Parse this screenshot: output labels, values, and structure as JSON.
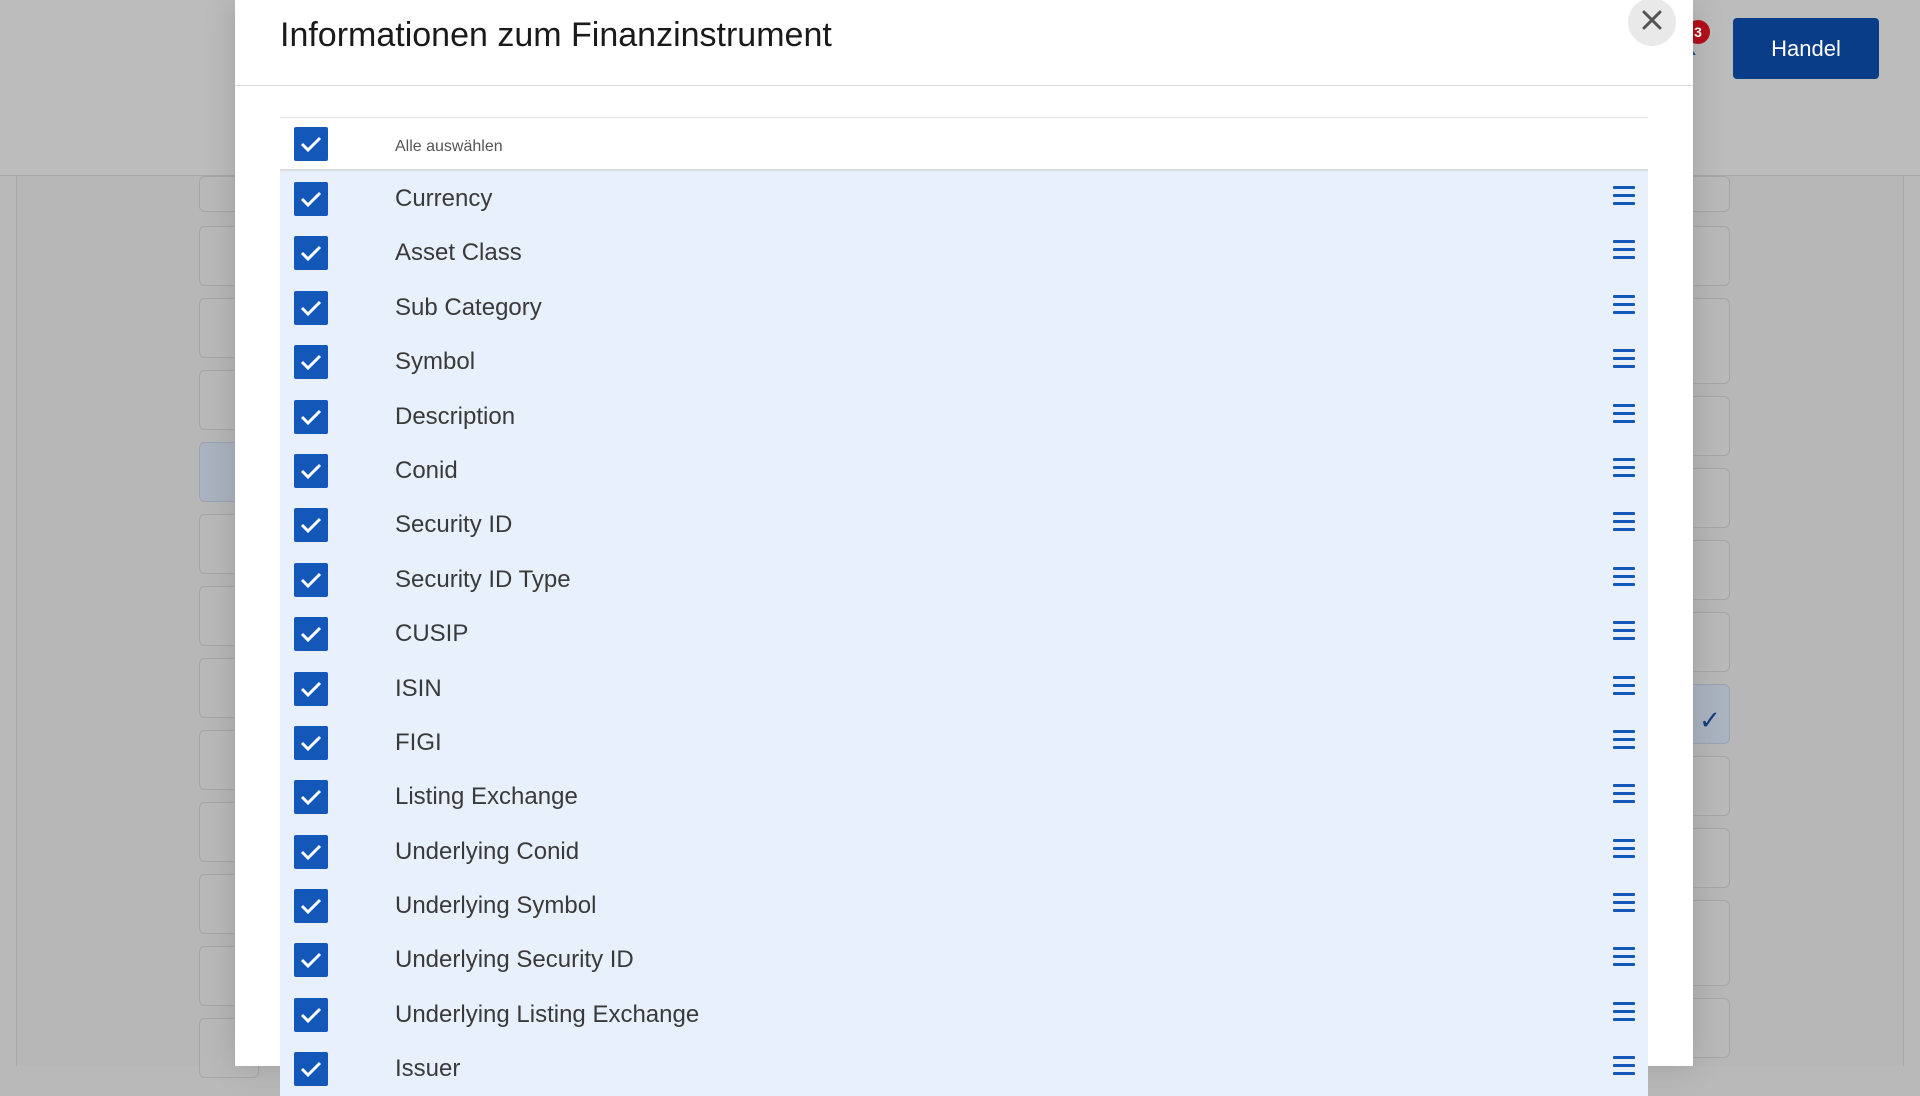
{
  "app": {
    "trade_button_label": "Handel",
    "notification_count": "3"
  },
  "modal": {
    "title": "Informationen zum Finanzinstrument",
    "close_icon": "close-icon",
    "select_all_label": "Alle auswählen",
    "select_all_checked": true,
    "items": [
      {
        "label": "Currency",
        "checked": true
      },
      {
        "label": "Asset Class",
        "checked": true
      },
      {
        "label": "Sub Category",
        "checked": true
      },
      {
        "label": "Symbol",
        "checked": true
      },
      {
        "label": "Description",
        "checked": true
      },
      {
        "label": "Conid",
        "checked": true
      },
      {
        "label": "Security ID",
        "checked": true
      },
      {
        "label": "Security ID Type",
        "checked": true
      },
      {
        "label": "CUSIP",
        "checked": true
      },
      {
        "label": "ISIN",
        "checked": true
      },
      {
        "label": "FIGI",
        "checked": true
      },
      {
        "label": "Listing Exchange",
        "checked": true
      },
      {
        "label": "Underlying Conid",
        "checked": true
      },
      {
        "label": "Underlying Symbol",
        "checked": true
      },
      {
        "label": "Underlying Security ID",
        "checked": true
      },
      {
        "label": "Underlying Listing Exchange",
        "checked": true
      },
      {
        "label": "Issuer",
        "checked": true
      }
    ]
  },
  "colors": {
    "accent": "#1358b8",
    "trade_button": "#0a3d87",
    "row_background": "#e8f0fb",
    "badge": "#b3101a"
  }
}
